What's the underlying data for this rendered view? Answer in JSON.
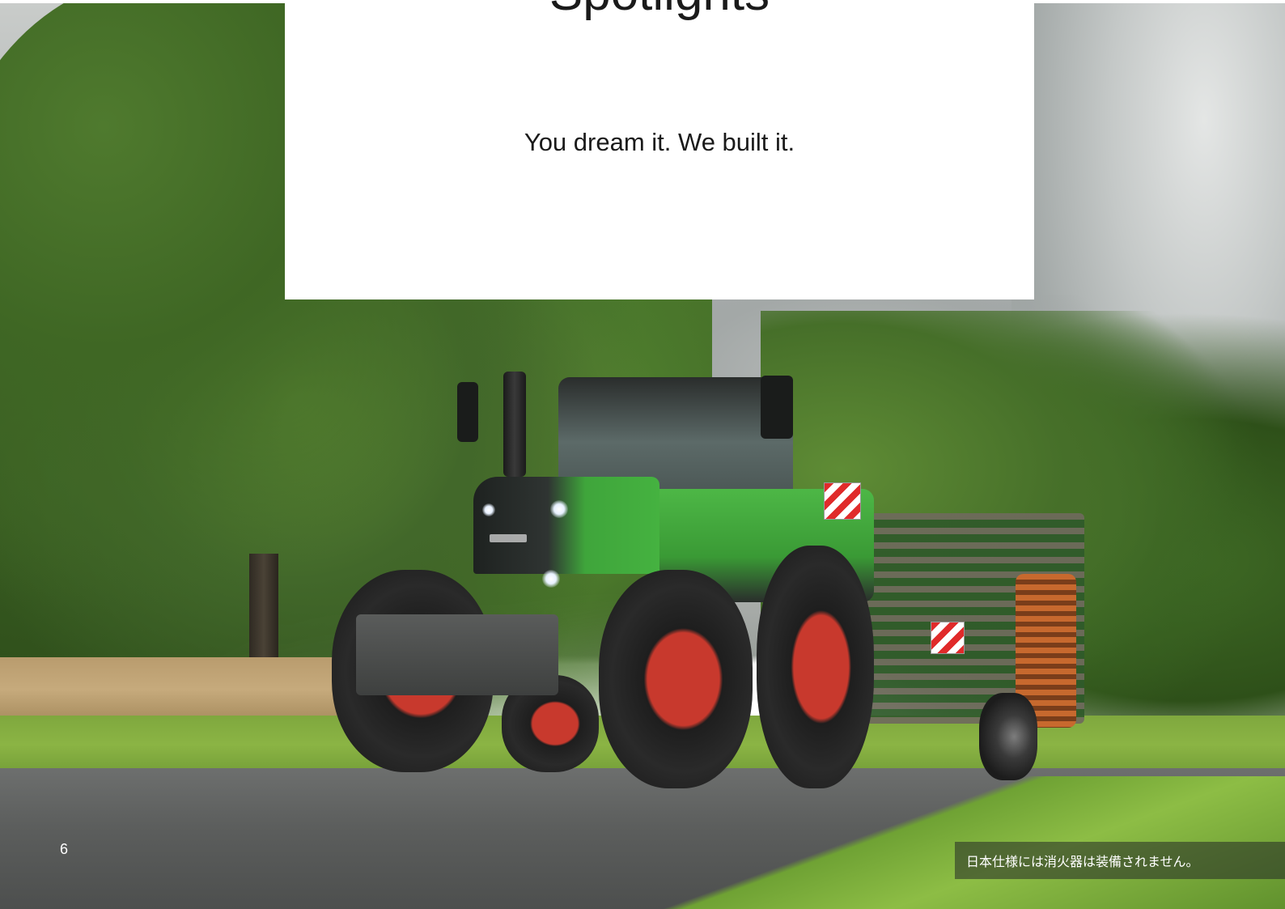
{
  "title": "Spotlights",
  "subtitle": "You dream it. We built it.",
  "page_number": "6",
  "disclaimer": "日本仕様には消火器は装備されません。",
  "photo": {
    "subject": "tractor-with-implement-photo"
  }
}
